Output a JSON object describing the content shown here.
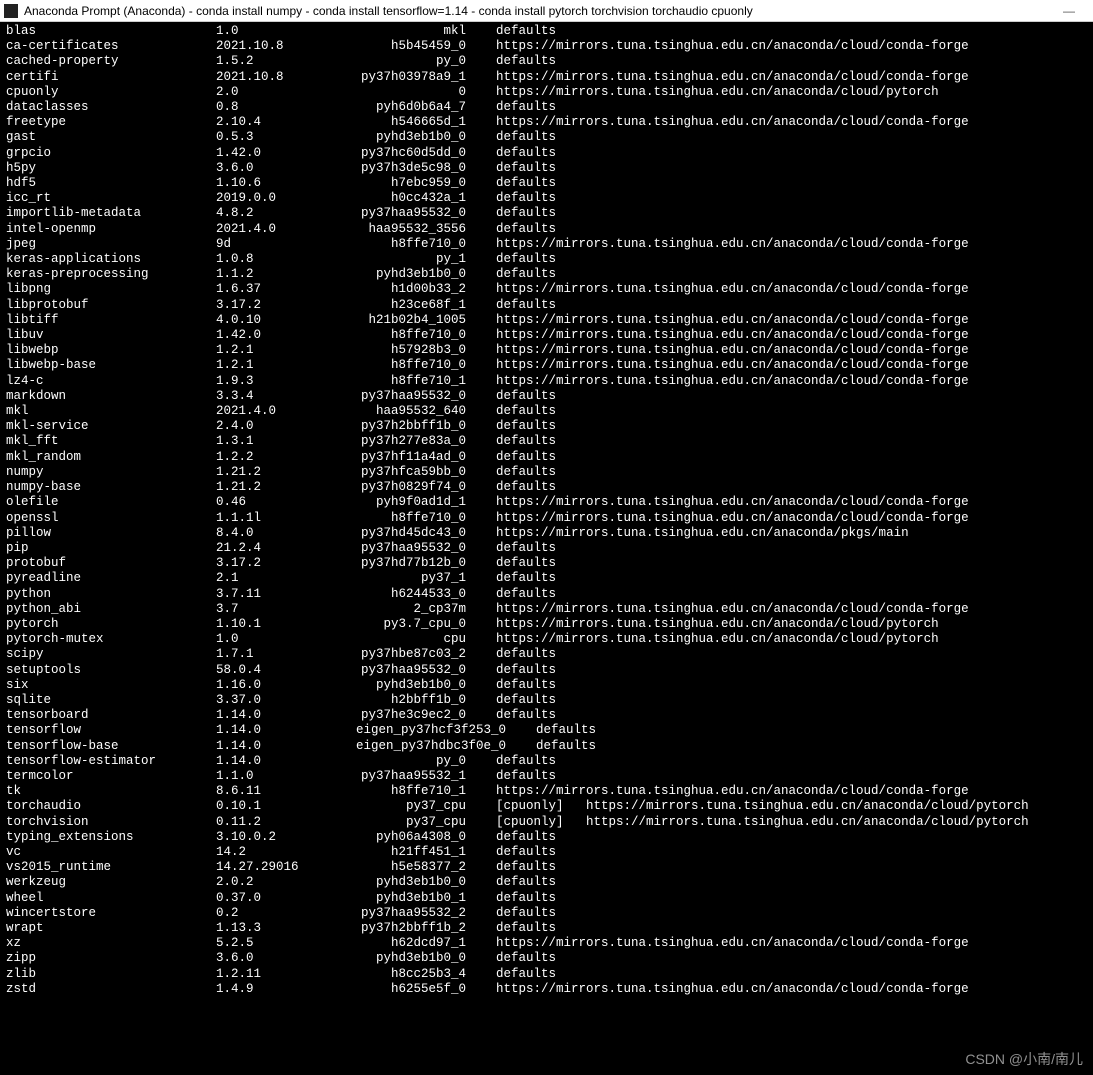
{
  "window": {
    "title": "Anaconda Prompt (Anaconda) - conda  install numpy - conda  install tensorflow=1.14 - conda  install pytorch torchvision torchaudio cpuonly",
    "min": "—"
  },
  "watermark": "CSDN @小南/南儿",
  "channels": {
    "defaults": "defaults",
    "forge": "https://mirrors.tuna.tsinghua.edu.cn/anaconda/cloud/conda-forge",
    "pytorch": "https://mirrors.tuna.tsinghua.edu.cn/anaconda/cloud/pytorch",
    "main": "https://mirrors.tuna.tsinghua.edu.cn/anaconda/pkgs/main"
  },
  "packages": [
    {
      "n": "blas",
      "v": "1.0",
      "b": "mkl",
      "c": "defaults"
    },
    {
      "n": "ca-certificates",
      "v": "2021.10.8",
      "b": "h5b45459_0",
      "c": "forge"
    },
    {
      "n": "cached-property",
      "v": "1.5.2",
      "b": "py_0",
      "c": "defaults"
    },
    {
      "n": "certifi",
      "v": "2021.10.8",
      "b": "py37h03978a9_1",
      "c": "forge"
    },
    {
      "n": "cpuonly",
      "v": "2.0",
      "b": "0",
      "c": "pytorch"
    },
    {
      "n": "dataclasses",
      "v": "0.8",
      "b": "pyh6d0b6a4_7",
      "c": "defaults"
    },
    {
      "n": "freetype",
      "v": "2.10.4",
      "b": "h546665d_1",
      "c": "forge"
    },
    {
      "n": "gast",
      "v": "0.5.3",
      "b": "pyhd3eb1b0_0",
      "c": "defaults"
    },
    {
      "n": "grpcio",
      "v": "1.42.0",
      "b": "py37hc60d5dd_0",
      "c": "defaults"
    },
    {
      "n": "h5py",
      "v": "3.6.0",
      "b": "py37h3de5c98_0",
      "c": "defaults"
    },
    {
      "n": "hdf5",
      "v": "1.10.6",
      "b": "h7ebc959_0",
      "c": "defaults"
    },
    {
      "n": "icc_rt",
      "v": "2019.0.0",
      "b": "h0cc432a_1",
      "c": "defaults"
    },
    {
      "n": "importlib-metadata",
      "v": "4.8.2",
      "b": "py37haa95532_0",
      "c": "defaults"
    },
    {
      "n": "intel-openmp",
      "v": "2021.4.0",
      "b": "haa95532_3556",
      "c": "defaults"
    },
    {
      "n": "jpeg",
      "v": "9d",
      "b": "h8ffe710_0",
      "c": "forge"
    },
    {
      "n": "keras-applications",
      "v": "1.0.8",
      "b": "py_1",
      "c": "defaults"
    },
    {
      "n": "keras-preprocessing",
      "v": "1.1.2",
      "b": "pyhd3eb1b0_0",
      "c": "defaults"
    },
    {
      "n": "libpng",
      "v": "1.6.37",
      "b": "h1d00b33_2",
      "c": "forge"
    },
    {
      "n": "libprotobuf",
      "v": "3.17.2",
      "b": "h23ce68f_1",
      "c": "defaults"
    },
    {
      "n": "libtiff",
      "v": "4.0.10",
      "b": "h21b02b4_1005",
      "c": "forge"
    },
    {
      "n": "libuv",
      "v": "1.42.0",
      "b": "h8ffe710_0",
      "c": "forge"
    },
    {
      "n": "libwebp",
      "v": "1.2.1",
      "b": "h57928b3_0",
      "c": "forge"
    },
    {
      "n": "libwebp-base",
      "v": "1.2.1",
      "b": "h8ffe710_0",
      "c": "forge"
    },
    {
      "n": "lz4-c",
      "v": "1.9.3",
      "b": "h8ffe710_1",
      "c": "forge"
    },
    {
      "n": "markdown",
      "v": "3.3.4",
      "b": "py37haa95532_0",
      "c": "defaults"
    },
    {
      "n": "mkl",
      "v": "2021.4.0",
      "b": "haa95532_640",
      "c": "defaults"
    },
    {
      "n": "mkl-service",
      "v": "2.4.0",
      "b": "py37h2bbff1b_0",
      "c": "defaults"
    },
    {
      "n": "mkl_fft",
      "v": "1.3.1",
      "b": "py37h277e83a_0",
      "c": "defaults"
    },
    {
      "n": "mkl_random",
      "v": "1.2.2",
      "b": "py37hf11a4ad_0",
      "c": "defaults"
    },
    {
      "n": "numpy",
      "v": "1.21.2",
      "b": "py37hfca59bb_0",
      "c": "defaults"
    },
    {
      "n": "numpy-base",
      "v": "1.21.2",
      "b": "py37h0829f74_0",
      "c": "defaults"
    },
    {
      "n": "olefile",
      "v": "0.46",
      "b": "pyh9f0ad1d_1",
      "c": "forge"
    },
    {
      "n": "openssl",
      "v": "1.1.1l",
      "b": "h8ffe710_0",
      "c": "forge"
    },
    {
      "n": "pillow",
      "v": "8.4.0",
      "b": "py37hd45dc43_0",
      "c": "main"
    },
    {
      "n": "pip",
      "v": "21.2.4",
      "b": "py37haa95532_0",
      "c": "defaults"
    },
    {
      "n": "protobuf",
      "v": "3.17.2",
      "b": "py37hd77b12b_0",
      "c": "defaults"
    },
    {
      "n": "pyreadline",
      "v": "2.1",
      "b": "py37_1",
      "c": "defaults"
    },
    {
      "n": "python",
      "v": "3.7.11",
      "b": "h6244533_0",
      "c": "defaults"
    },
    {
      "n": "python_abi",
      "v": "3.7",
      "b": "2_cp37m",
      "c": "forge"
    },
    {
      "n": "pytorch",
      "v": "1.10.1",
      "b": "py3.7_cpu_0",
      "c": "pytorch"
    },
    {
      "n": "pytorch-mutex",
      "v": "1.0",
      "b": "cpu",
      "c": "pytorch"
    },
    {
      "n": "scipy",
      "v": "1.7.1",
      "b": "py37hbe87c03_2",
      "c": "defaults"
    },
    {
      "n": "setuptools",
      "v": "58.0.4",
      "b": "py37haa95532_0",
      "c": "defaults"
    },
    {
      "n": "six",
      "v": "1.16.0",
      "b": "pyhd3eb1b0_0",
      "c": "defaults"
    },
    {
      "n": "sqlite",
      "v": "3.37.0",
      "b": "h2bbff1b_0",
      "c": "defaults"
    },
    {
      "n": "tensorboard",
      "v": "1.14.0",
      "b": "py37he3c9ec2_0",
      "c": "defaults"
    },
    {
      "n": "tensorflow",
      "v": "1.14.0",
      "b": "eigen_py37hcf3f253_0",
      "c": "defaults",
      "wide": true
    },
    {
      "n": "tensorflow-base",
      "v": "1.14.0",
      "b": "eigen_py37hdbc3f0e_0",
      "c": "defaults",
      "wide": true
    },
    {
      "n": "tensorflow-estimator",
      "v": "1.14.0",
      "b": "py_0",
      "c": "defaults"
    },
    {
      "n": "termcolor",
      "v": "1.1.0",
      "b": "py37haa95532_1",
      "c": "defaults"
    },
    {
      "n": "tk",
      "v": "8.6.11",
      "b": "h8ffe710_1",
      "c": "forge"
    },
    {
      "n": "torchaudio",
      "v": "0.10.1",
      "b": "py37_cpu",
      "c": "pytorch",
      "extra": "[cpuonly]"
    },
    {
      "n": "torchvision",
      "v": "0.11.2",
      "b": "py37_cpu",
      "c": "pytorch",
      "extra": "[cpuonly]"
    },
    {
      "n": "typing_extensions",
      "v": "3.10.0.2",
      "b": "pyh06a4308_0",
      "c": "defaults"
    },
    {
      "n": "vc",
      "v": "14.2",
      "b": "h21ff451_1",
      "c": "defaults"
    },
    {
      "n": "vs2015_runtime",
      "v": "14.27.29016",
      "b": "h5e58377_2",
      "c": "defaults"
    },
    {
      "n": "werkzeug",
      "v": "2.0.2",
      "b": "pyhd3eb1b0_0",
      "c": "defaults"
    },
    {
      "n": "wheel",
      "v": "0.37.0",
      "b": "pyhd3eb1b0_1",
      "c": "defaults"
    },
    {
      "n": "wincertstore",
      "v": "0.2",
      "b": "py37haa95532_2",
      "c": "defaults"
    },
    {
      "n": "wrapt",
      "v": "1.13.3",
      "b": "py37h2bbff1b_2",
      "c": "defaults"
    },
    {
      "n": "xz",
      "v": "5.2.5",
      "b": "h62dcd97_1",
      "c": "forge"
    },
    {
      "n": "zipp",
      "v": "3.6.0",
      "b": "pyhd3eb1b0_0",
      "c": "defaults"
    },
    {
      "n": "zlib",
      "v": "1.2.11",
      "b": "h8cc25b3_4",
      "c": "defaults"
    },
    {
      "n": "zstd",
      "v": "1.4.9",
      "b": "h6255e5f_0",
      "c": "forge"
    }
  ]
}
